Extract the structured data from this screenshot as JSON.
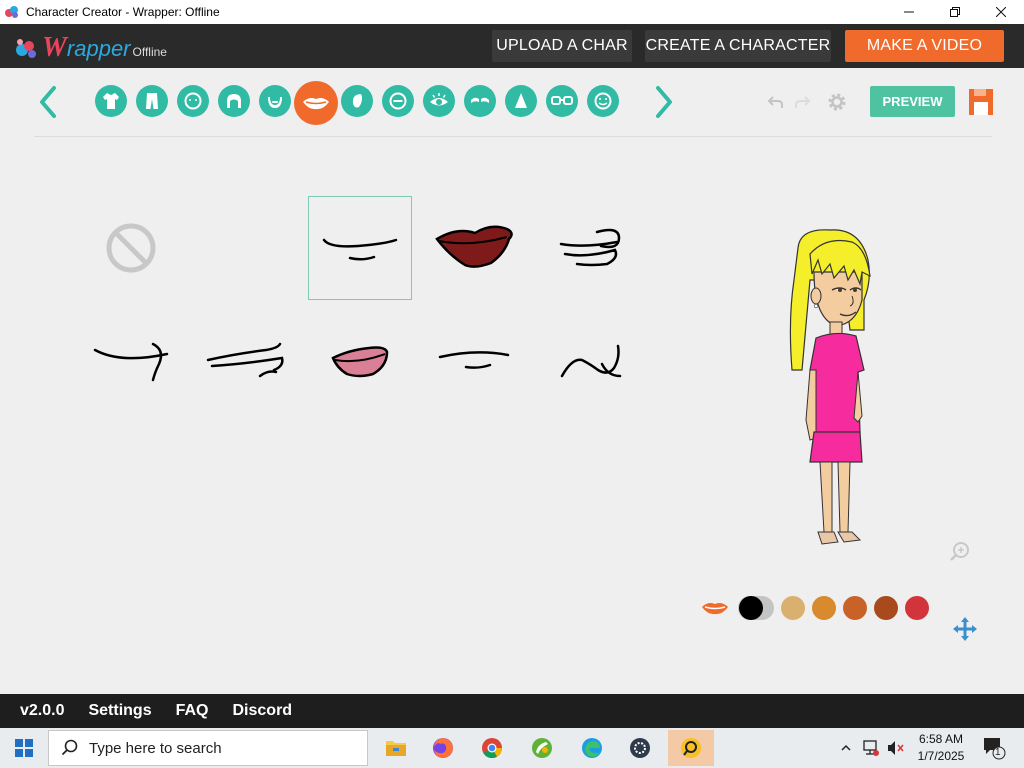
{
  "window": {
    "title": "Character Creator - Wrapper: Offline",
    "controls": [
      "minimize",
      "restore",
      "close"
    ]
  },
  "logo": {
    "w": "W",
    "rest": "rapper",
    "suffix": "Offline"
  },
  "topbar": {
    "upload_label": "UPLOAD A CHAR",
    "create_label": "CREATE A CHARACTER",
    "make_label": "MAKE A VIDEO"
  },
  "toolbar": {
    "categories": [
      {
        "icon": "shirt-icon"
      },
      {
        "icon": "pants-icon"
      },
      {
        "icon": "face-shape-icon"
      },
      {
        "icon": "hair-icon"
      },
      {
        "icon": "beard-icon"
      },
      {
        "icon": "mouth-icon",
        "active": true
      },
      {
        "icon": "ear-icon"
      },
      {
        "icon": "minus-icon"
      },
      {
        "icon": "eye-icon"
      },
      {
        "icon": "eyebrow-icon"
      },
      {
        "icon": "nose-icon"
      },
      {
        "icon": "glasses-icon"
      },
      {
        "icon": "face-details-icon"
      }
    ],
    "preview_label": "PREVIEW"
  },
  "mouth_options": [
    {
      "style": "none"
    },
    {
      "style": "smile-line",
      "selected": true
    },
    {
      "style": "dark-red-lips"
    },
    {
      "style": "side-smirk"
    },
    {
      "style": "hook-smile"
    },
    {
      "style": "wide-line"
    },
    {
      "style": "pink-lips"
    },
    {
      "style": "thin-line"
    },
    {
      "style": "curl"
    }
  ],
  "palette": {
    "colors": [
      "#000000",
      "#d9b06d",
      "#d88a2e",
      "#c96229",
      "#a84a1c",
      "#d2343c"
    ],
    "selected": "#000000"
  },
  "footer": {
    "version": "v2.0.0",
    "settings": "Settings",
    "faq": "FAQ",
    "discord": "Discord"
  },
  "taskbar": {
    "search_placeholder": "Type here to search",
    "apps": [
      "file-explorer-icon",
      "firefox-icon",
      "chrome-icon",
      "gimp-icon",
      "edge-icon",
      "settings-app-icon",
      "wrapper-app-icon"
    ],
    "time": "6:58 AM",
    "date": "1/7/2025",
    "notification_count": "1"
  },
  "colors": {
    "accent_teal": "#31bba5",
    "accent_orange": "#f06a2c",
    "preview_green": "#4fc3a1"
  }
}
